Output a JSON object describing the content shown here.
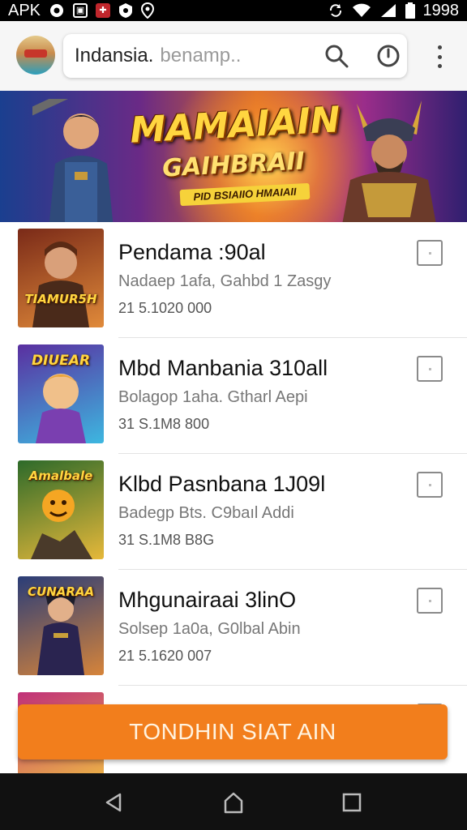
{
  "status_bar": {
    "left_label": "APK",
    "time": "1998"
  },
  "search": {
    "value": "Indansia.",
    "placeholder": "benamp.."
  },
  "banner": {
    "title": "MAMAIAIN",
    "subtitle": "GAIHBRAII",
    "tag": "PID BSIAIIO HMAIAII"
  },
  "games": [
    {
      "title": "Pendama :90al",
      "subtitle": "Nadaep 1afa, Gahbd 1 Zasgy",
      "meta": "21 5.1020 000",
      "thumb_label": "TIAMUR5H",
      "colors": [
        "#7a2a18",
        "#e08a3a"
      ]
    },
    {
      "title": "Mbd Manbania 310all",
      "subtitle": "Bolagop 1aha. Gtharl Aepi",
      "meta": "31 S.1M8 800",
      "thumb_label": "DIUEAR",
      "colors": [
        "#5a2fa0",
        "#3db7e0"
      ]
    },
    {
      "title": "Klbd Pasnbana 1J09l",
      "subtitle": "Badegp Bts. C9baıl Addi",
      "meta": "31 S.1M8 B8G",
      "thumb_label": "Amalbale",
      "colors": [
        "#2d6a2a",
        "#e6b83a"
      ]
    },
    {
      "title": "Mhgunairaai 3linO",
      "subtitle": "Solsep 1a0a, G0lbal Abin",
      "meta": "21 5.1620 007",
      "thumb_label": "CUNARAA",
      "colors": [
        "#2a3d78",
        "#d6843a"
      ]
    }
  ],
  "cta": {
    "label": "TONDHIN SIAT AIN"
  },
  "colors": {
    "accent": "#f27e1c",
    "status_bar": "#000000",
    "nav_bar": "#111111"
  },
  "icons": [
    "wifi-icon",
    "signal-icon",
    "battery-icon",
    "search-icon",
    "timer-icon",
    "more-vert-icon",
    "back-icon",
    "home-icon",
    "recents-icon"
  ]
}
